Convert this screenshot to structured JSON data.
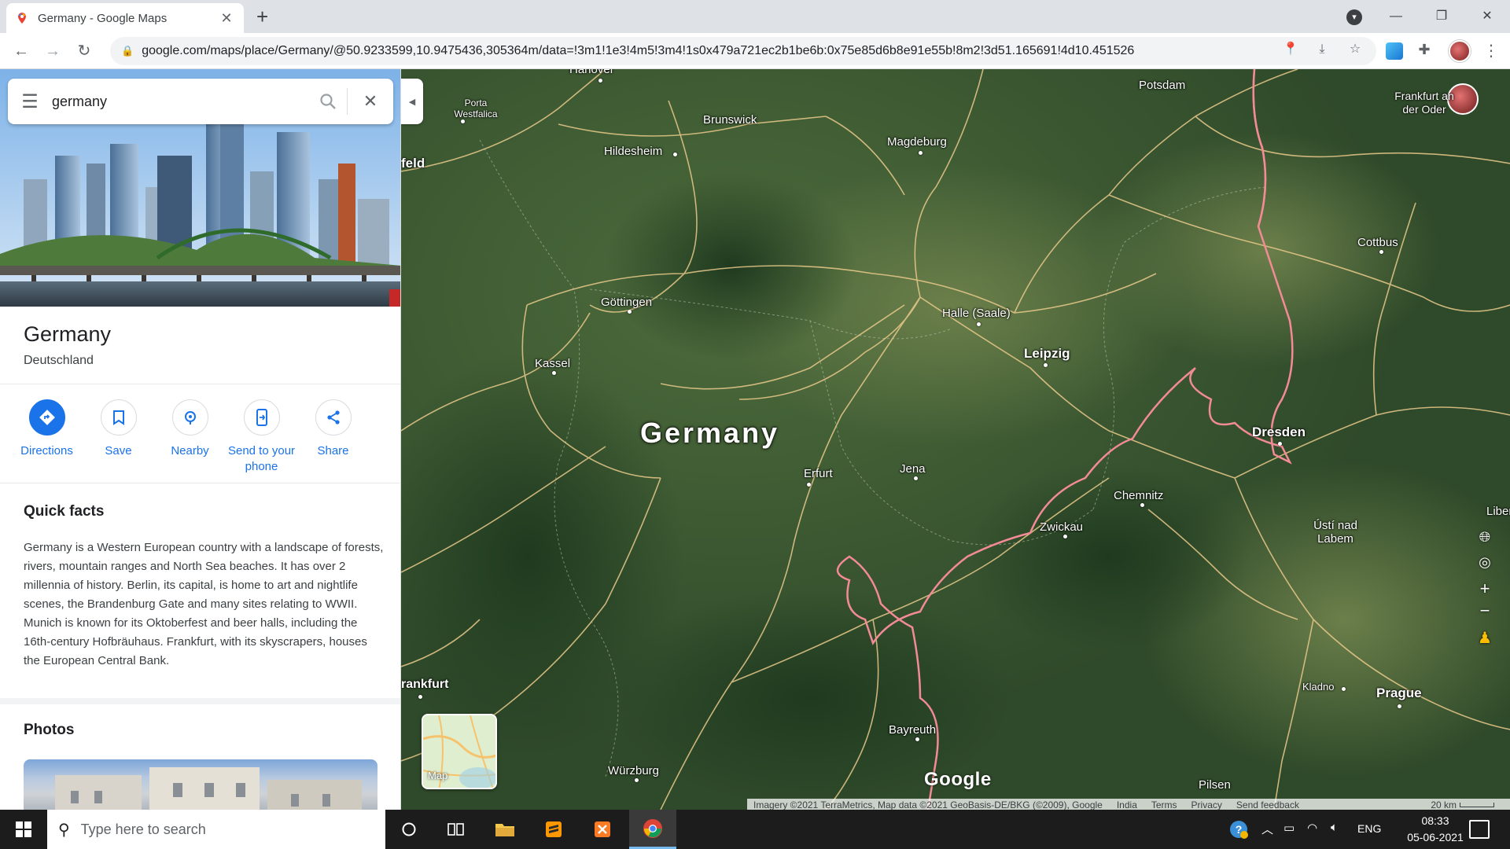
{
  "browser": {
    "tab_title": "Germany - Google Maps",
    "url": "google.com/maps/place/Germany/@50.9233599,10.9475436,305364m/data=!3m1!1e3!4m5!3m4!1s0x479a721ec2b1be6b:0x75e85d6b8e91e55b!8m2!3d51.165691!4d10.451526"
  },
  "search": {
    "value": "germany"
  },
  "place": {
    "title": "Germany",
    "subtitle": "Deutschland",
    "actions": [
      {
        "label": "Directions"
      },
      {
        "label": "Save"
      },
      {
        "label": "Nearby"
      },
      {
        "label": "Send to your phone"
      },
      {
        "label": "Share"
      }
    ],
    "quick_facts_heading": "Quick facts",
    "quick_facts_text": "Germany is a Western European country with a landscape of forests, rivers, mountain ranges and North Sea beaches. It has over 2 millennia of history. Berlin, its capital, is home to art and nightlife scenes, the Brandenburg Gate and many sites relating to WWII. Munich is known for its Oktoberfest and beer halls, including the 16th-century Hofbräuhaus. Frankfurt, with its skyscrapers, houses the European Central Bank.",
    "photos_heading": "Photos"
  },
  "map": {
    "country_label": "Germany",
    "cities": [
      {
        "name": "Hanover"
      },
      {
        "name": "Porta Westfalica"
      },
      {
        "name": "Brunswick"
      },
      {
        "name": "Magdeburg"
      },
      {
        "name": "Potsdam"
      },
      {
        "name": "Frankfurt an der Oder"
      },
      {
        "name": "feld"
      },
      {
        "name": "Hildesheim"
      },
      {
        "name": "Cottbus"
      },
      {
        "name": "Göttingen"
      },
      {
        "name": "Halle (Saale)"
      },
      {
        "name": "Kassel"
      },
      {
        "name": "Leipzig"
      },
      {
        "name": "Dresden"
      },
      {
        "name": "Erfurt"
      },
      {
        "name": "Jena"
      },
      {
        "name": "Chemnitz"
      },
      {
        "name": "Zwickau"
      },
      {
        "name": "Ústí nad Labem"
      },
      {
        "name": "Liber"
      },
      {
        "name": "Kladno"
      },
      {
        "name": "Prague"
      },
      {
        "name": "rankfurt"
      },
      {
        "name": "Bayreuth"
      },
      {
        "name": "Würzburg"
      },
      {
        "name": "Pilsen"
      }
    ],
    "layer_toggle_label": "Map",
    "logo": "Google",
    "attribution": "Imagery ©2021 TerraMetrics, Map data ©2021 GeoBasis-DE/BKG (©2009), Google",
    "links": [
      "India",
      "Terms",
      "Privacy",
      "Send feedback"
    ],
    "scale": "20 km"
  },
  "taskbar": {
    "search_placeholder": "Type here to search",
    "language": "ENG",
    "time": "08:33",
    "date": "05-06-2021"
  },
  "colors": {
    "accent": "#1a73e8",
    "border_line": "#f28b95",
    "road": "#e8c98a"
  },
  "icons": {
    "tab_favicon": "maps-pin-icon",
    "new_tab": "plus-icon",
    "menu": "hamburger-icon",
    "search": "search-icon",
    "clear": "close-icon",
    "directions": "directions-icon",
    "save": "bookmark-icon",
    "nearby": "nearby-icon",
    "send": "phone-icon",
    "share": "share-icon"
  }
}
